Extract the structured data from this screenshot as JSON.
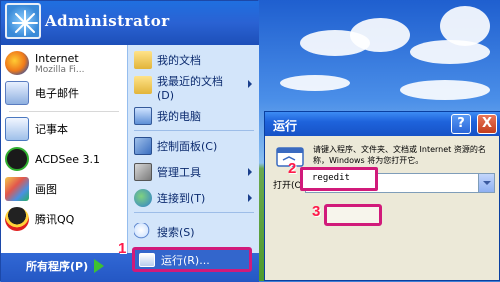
{
  "start_menu": {
    "user_name": "Administrator",
    "pinned": [
      {
        "label": "Internet",
        "sublabel": "Mozilla Fi...",
        "icon": "firefox-icon"
      },
      {
        "label": "电子邮件",
        "icon": "email-icon"
      }
    ],
    "recent": [
      {
        "label": "记事本",
        "icon": "notepad-icon"
      },
      {
        "label": "ACDSee 3.1",
        "icon": "acdsee-icon"
      },
      {
        "label": "画图",
        "icon": "paint-icon"
      },
      {
        "label": "腾讯QQ",
        "icon": "qq-icon"
      }
    ],
    "right": [
      {
        "label": "我的文档",
        "icon": "my-documents-icon"
      },
      {
        "label": "我最近的文档",
        "label2": "(D)",
        "icon": "recent-documents-icon"
      },
      {
        "label": "我的电脑",
        "icon": "my-computer-icon"
      },
      {
        "label": "控制面板(C)",
        "icon": "control-panel-icon"
      },
      {
        "label": "管理工具",
        "icon": "admin-tools-icon"
      },
      {
        "label": "连接到(T)",
        "icon": "connect-to-icon"
      },
      {
        "label": "搜索(S)",
        "icon": "search-icon"
      },
      {
        "label": "运行(R)...",
        "icon": "run-icon"
      }
    ],
    "all_programs": "所有程序(P)"
  },
  "steps": {
    "one": "1",
    "two": "2",
    "three": "3"
  },
  "run_dialog": {
    "title": "运行",
    "help": "?",
    "close": "X",
    "description": "请键入程序、文件夹、文档或 Internet 资源的名称，Windows 将为您打开它。",
    "open_label": "打开(O):",
    "input_value": "regedit"
  },
  "colors": {
    "highlight": "#d11a7a",
    "step_number": "#ff1a4a",
    "title_bar": "#1e63dc"
  }
}
